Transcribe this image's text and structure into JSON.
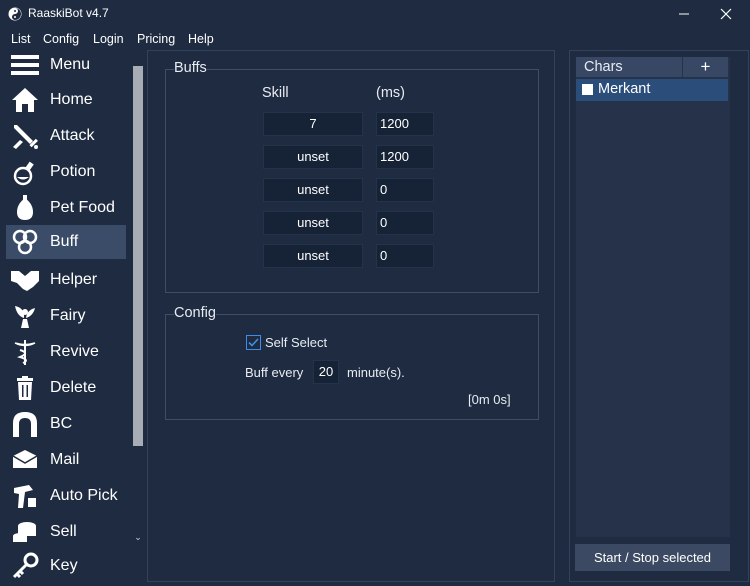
{
  "window": {
    "title": "RaaskiBot v4.7",
    "minimize_glyph": "—",
    "close_glyph": "✕"
  },
  "menubar": {
    "items": [
      "List",
      "Config",
      "Login",
      "Pricing",
      "Help"
    ]
  },
  "sidebar": {
    "items": [
      {
        "label": "Menu",
        "icon": "hamburger-icon"
      },
      {
        "label": "Home",
        "icon": "home-icon"
      },
      {
        "label": "Attack",
        "icon": "sword-icon"
      },
      {
        "label": "Potion",
        "icon": "potion-icon"
      },
      {
        "label": "Pet Food",
        "icon": "pet-food-icon"
      },
      {
        "label": "Buff",
        "icon": "buff-swirl-icon",
        "active": true
      },
      {
        "label": "Helper",
        "icon": "handshake-icon"
      },
      {
        "label": "Fairy",
        "icon": "fairy-icon"
      },
      {
        "label": "Revive",
        "icon": "caduceus-icon"
      },
      {
        "label": "Delete",
        "icon": "trash-icon"
      },
      {
        "label": "BC",
        "icon": "gate-icon"
      },
      {
        "label": "Mail",
        "icon": "mail-icon"
      },
      {
        "label": "Auto Pick",
        "icon": "pick-hand-icon"
      },
      {
        "label": "Sell",
        "icon": "coins-icon"
      },
      {
        "label": "Key",
        "icon": "key-icon"
      }
    ],
    "scroll_down_glyph": "⌄"
  },
  "buffs": {
    "title": "Buffs",
    "skill_header": "Skill",
    "ms_header": "(ms)",
    "rows": [
      {
        "skill": "7",
        "ms": "1200"
      },
      {
        "skill": "unset",
        "ms": "1200"
      },
      {
        "skill": "unset",
        "ms": "0"
      },
      {
        "skill": "unset",
        "ms": "0"
      },
      {
        "skill": "unset",
        "ms": "0"
      }
    ]
  },
  "config": {
    "title": "Config",
    "self_select_label": "Self Select",
    "self_select_checked": true,
    "buff_every_label": "Buff every",
    "buff_every_value": "20",
    "unit_label": "minute(s).",
    "timer": "[0m 0s]"
  },
  "chars": {
    "title": "Chars",
    "add_label": "+",
    "list": [
      {
        "name": "Merkant",
        "checked": false
      }
    ],
    "start_stop_label": "Start / Stop selected"
  },
  "colors": {
    "background": "#1e2b40",
    "selection": "#2b4d7a",
    "accent": "#3d8ee8"
  }
}
